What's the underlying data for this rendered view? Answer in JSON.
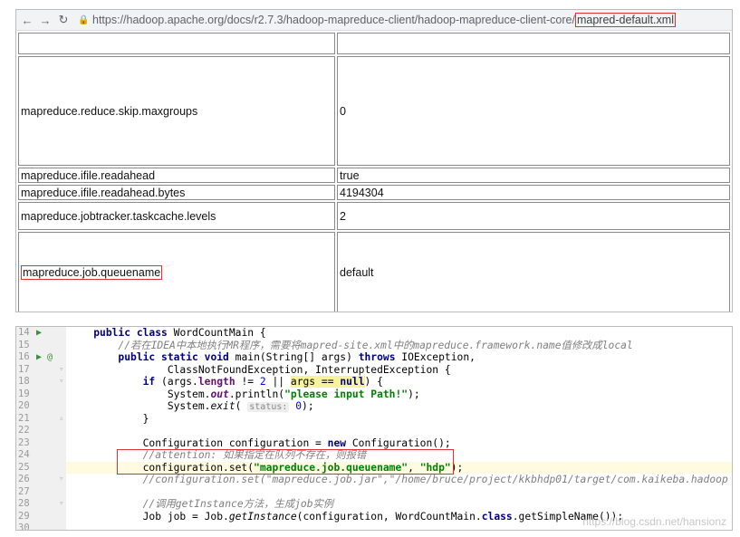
{
  "browser": {
    "url_base": "https://hadoop.apache.org/docs/r2.7.3/hadoop-mapreduce-client/hadoop-mapreduce-client-core/",
    "url_file": "mapred-default.xml",
    "rows": [
      {
        "name": "",
        "value": ""
      },
      {
        "name": "mapreduce.reduce.skip.maxgroups",
        "value": "0"
      },
      {
        "name": "mapreduce.ifile.readahead",
        "value": "true"
      },
      {
        "name": "mapreduce.ifile.readahead.bytes",
        "value": "4194304"
      },
      {
        "name": "mapreduce.jobtracker.taskcache.levels",
        "value": "2"
      },
      {
        "name": "mapreduce.job.queuename",
        "value": "default"
      }
    ]
  },
  "editor": {
    "lines": [
      {
        "n": "14"
      },
      {
        "n": "15"
      },
      {
        "n": "16"
      },
      {
        "n": "17"
      },
      {
        "n": "18"
      },
      {
        "n": "19"
      },
      {
        "n": "20"
      },
      {
        "n": "21"
      },
      {
        "n": "22"
      },
      {
        "n": "23"
      },
      {
        "n": "24"
      },
      {
        "n": "25"
      },
      {
        "n": "26"
      },
      {
        "n": "27"
      },
      {
        "n": "28"
      },
      {
        "n": "29"
      },
      {
        "n": "30"
      }
    ],
    "watermark": "https://blog.csdn.net/hansionz"
  }
}
